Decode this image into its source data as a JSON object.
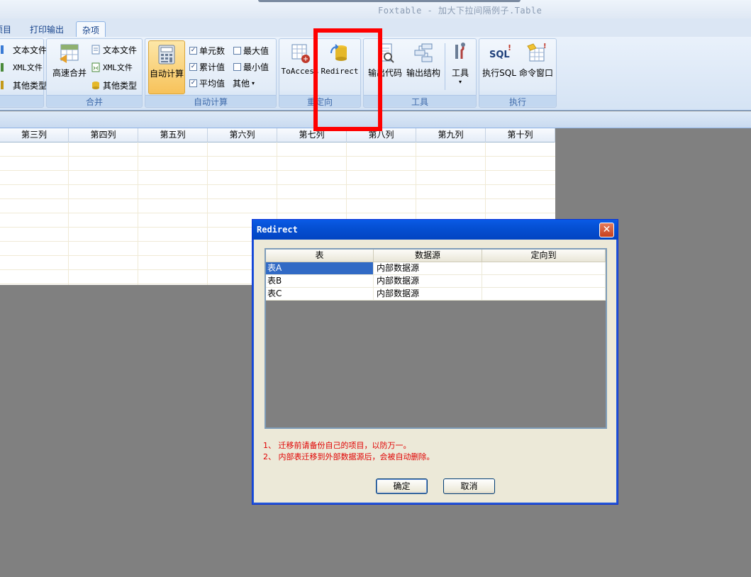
{
  "window": {
    "title": "Foxtable - 加大下拉间隔例子.Table"
  },
  "tabs": [
    {
      "label": "项目"
    },
    {
      "label": "打印输出"
    },
    {
      "label": "杂项"
    }
  ],
  "ribbon": {
    "group_import": {
      "items": [
        "文本文件",
        "XML文件",
        "其他类型"
      ]
    },
    "group_merge": {
      "label": "合并",
      "large": "高速合并",
      "items": [
        "文本文件",
        "XML文件",
        "其他类型"
      ]
    },
    "group_autocalc": {
      "label": "自动计算",
      "large": "自动计算",
      "checks": [
        {
          "label": "单元数",
          "checked": true
        },
        {
          "label": "累计值",
          "checked": true
        },
        {
          "label": "平均值",
          "checked": true
        },
        {
          "label": "最大值",
          "checked": false
        },
        {
          "label": "最小值",
          "checked": false
        }
      ],
      "other": "其他"
    },
    "group_redirect": {
      "label": "重定向",
      "buttons": [
        "ToAccess",
        "Redirect"
      ]
    },
    "group_tools": {
      "label": "工具",
      "buttons": [
        "输出代码",
        "输出结构",
        "工具"
      ]
    },
    "group_exec": {
      "label": "执行",
      "buttons": [
        "执行SQL",
        "命令窗口"
      ]
    }
  },
  "grid": {
    "columns": [
      "第三列",
      "第四列",
      "第五列",
      "第六列",
      "第七列",
      "第八列",
      "第九列",
      "第十列"
    ]
  },
  "dialog": {
    "title": "Redirect",
    "columns": [
      "表",
      "数据源",
      "定向到"
    ],
    "rows": [
      [
        "表A",
        "内部数据源",
        ""
      ],
      [
        "表B",
        "内部数据源",
        ""
      ],
      [
        "表C",
        "内部数据源",
        ""
      ]
    ],
    "notes": [
      "1、 迁移前请备份自己的项目，以防万一。",
      "2、 内部表迁移到外部数据源后，会被自动删除。"
    ],
    "ok_label": "确定",
    "cancel_label": "取消"
  },
  "colors": {
    "annotation": "#ff0000",
    "selection": "#316ac5",
    "note_text": "#e00000"
  }
}
